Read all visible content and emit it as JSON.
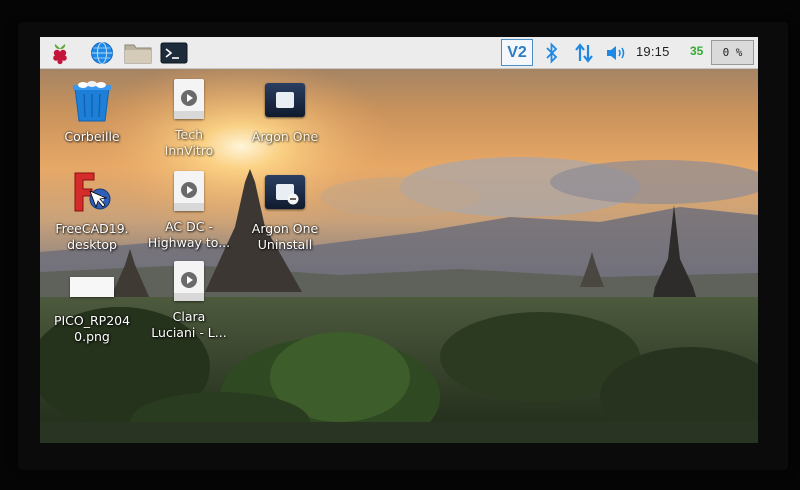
{
  "panel": {
    "menu_icon": "raspberry-menu-icon",
    "browser_icon": "globe-icon",
    "filemanager_icon": "folder-icon",
    "terminal_icon": "terminal-icon",
    "vnc_label": "V2",
    "bluetooth_icon": "bluetooth-icon",
    "network_icon": "network-arrows-icon",
    "volume_icon": "speaker-icon",
    "clock": "19:15",
    "cpu_temp": "35",
    "cpu_usage": "0 %"
  },
  "desktop": {
    "icons": [
      {
        "label": "Corbeille",
        "icon": "trash-bin-icon"
      },
      {
        "label": "Tech\nInnVitro",
        "icon": "media-file-icon"
      },
      {
        "label": "Argon One",
        "icon": "argon-one-icon"
      },
      {
        "label": "FreeCAD19.\ndesktop",
        "icon": "freecad-icon"
      },
      {
        "label": "AC DC -\nHighway to...",
        "icon": "media-file-icon"
      },
      {
        "label": "Argon One\nUninstall",
        "icon": "argon-uninstall-icon"
      },
      {
        "label": "PICO_RP204\n0.png",
        "icon": "image-file-icon"
      },
      {
        "label": "Clara\nLuciani - L...",
        "icon": "media-file-icon"
      }
    ]
  },
  "colors": {
    "panel_bg": "#ececec",
    "accent_blue": "#1e88e5",
    "cpu_temp_green": "#33aa33"
  }
}
